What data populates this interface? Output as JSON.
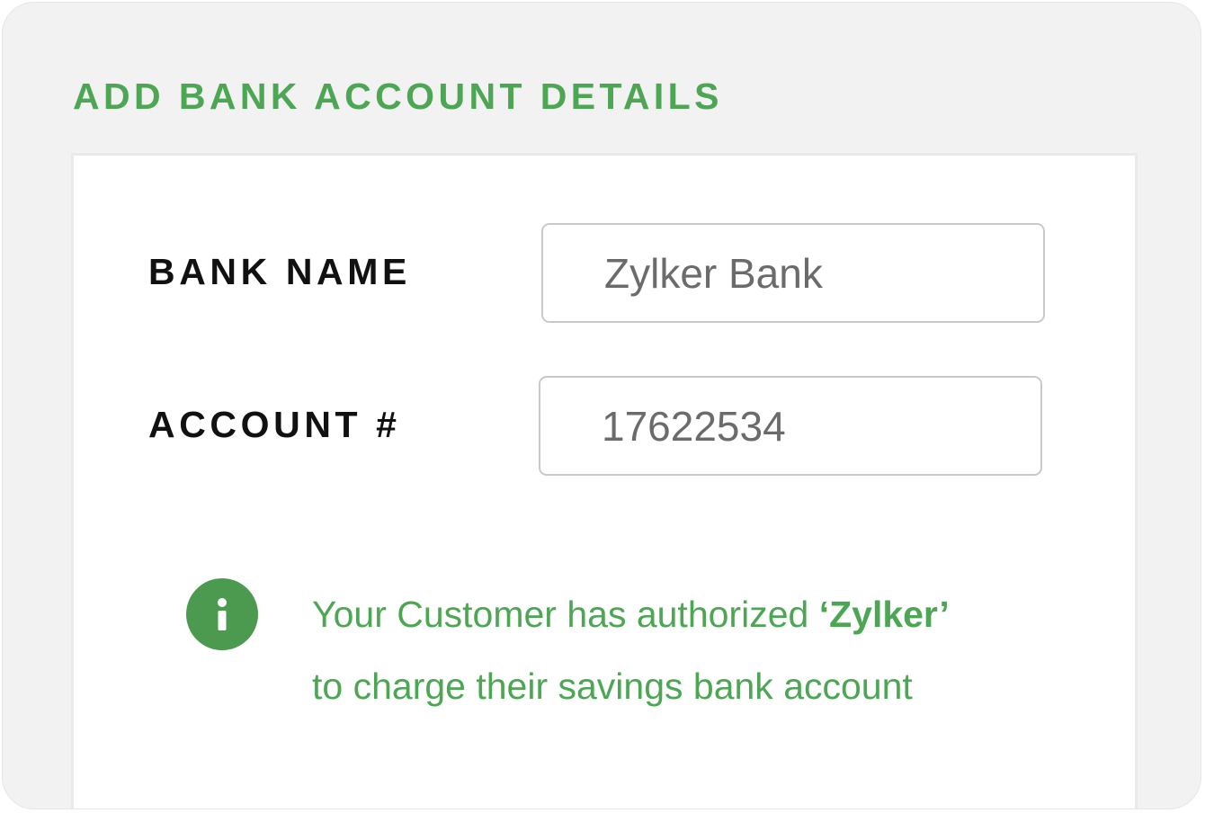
{
  "section": {
    "title": "ADD BANK ACCOUNT DETAILS"
  },
  "form": {
    "bank_name": {
      "label": "BANK NAME",
      "value": "Zylker Bank"
    },
    "account_number": {
      "label": "ACCOUNT #",
      "value": "17622534"
    }
  },
  "notice": {
    "icon": "info-icon",
    "line1_prefix": "Your Customer has authorized ",
    "line1_brand": "‘Zylker’",
    "line2": "to charge their savings bank account"
  },
  "colors": {
    "accent_green": "#4ca654",
    "icon_green": "#4c9a4f",
    "label_text": "#111111",
    "field_text": "#6b6b6b",
    "field_border": "#c9c9c9",
    "outer_background": "#f2f2f2"
  }
}
